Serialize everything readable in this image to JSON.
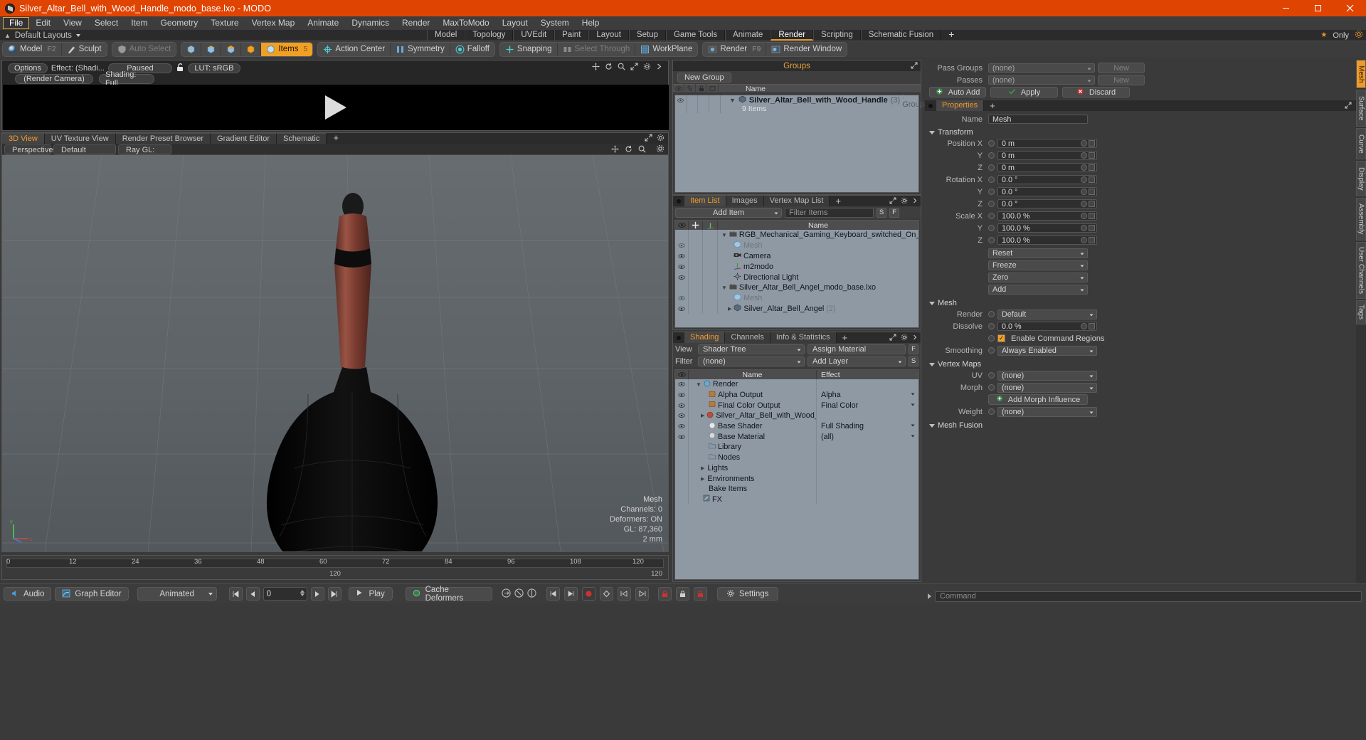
{
  "titlebar": {
    "title": "Silver_Altar_Bell_with_Wood_Handle_modo_base.lxo - MODO",
    "minimize": "—",
    "maximize": "❐",
    "close": "✕"
  },
  "menu": {
    "items": [
      "File",
      "Edit",
      "View",
      "Select",
      "Item",
      "Geometry",
      "Texture",
      "Vertex Map",
      "Animate",
      "Dynamics",
      "Render",
      "MaxToModo",
      "Layout",
      "System",
      "Help"
    ],
    "active": "File"
  },
  "layoutbar": {
    "label": "Default Layouts",
    "tabs": [
      "Model",
      "Topology",
      "UVEdit",
      "Paint",
      "Layout",
      "Setup",
      "Game Tools",
      "Animate",
      "Render",
      "Scripting",
      "Schematic Fusion"
    ],
    "selected": "Render",
    "plus": "+",
    "only_label": "Only"
  },
  "modebar": {
    "group1": [
      {
        "label": "Model",
        "hotkey": "F2",
        "icon": "sphere-icon"
      },
      {
        "label": "Sculpt",
        "hotkey": "",
        "icon": "brush-icon"
      }
    ],
    "group2": [
      {
        "label": "Auto Select",
        "hotkey": "",
        "icon": "shield-icon",
        "dim": true
      }
    ],
    "group3": [
      {
        "label": "",
        "icon": "vertex-icon"
      },
      {
        "label": "",
        "icon": "edge-icon"
      },
      {
        "label": "",
        "icon": "polygon-icon"
      },
      {
        "label": "",
        "icon": "material-icon"
      },
      {
        "label": "Items",
        "hotkey": "5",
        "icon": "items-icon",
        "on": true
      }
    ],
    "group4": [
      {
        "label": "Action Center",
        "icon": "action-center-icon"
      },
      {
        "label": "Symmetry",
        "icon": "symmetry-icon"
      },
      {
        "label": "Falloff",
        "icon": "falloff-icon"
      }
    ],
    "group5": [
      {
        "label": "Snapping",
        "icon": "snapping-icon"
      },
      {
        "label": "Select Through",
        "icon": "select-through-icon",
        "dim": true
      },
      {
        "label": "WorkPlane",
        "icon": "workplane-icon"
      }
    ],
    "group6": [
      {
        "label": "Render",
        "hotkey": "F9",
        "icon": "render-icon"
      },
      {
        "label": "Render Window",
        "hotkey": "",
        "icon": "render-window-icon"
      }
    ]
  },
  "render_preview": {
    "options": "Options",
    "effect": "Effect: (Shadi...",
    "paused": "Paused",
    "lut": "LUT: sRGB",
    "camera": "(Render Camera)",
    "shading": "Shading: Full"
  },
  "viewport": {
    "tabs": [
      "3D View",
      "UV Texture View",
      "Render Preset Browser",
      "Gradient Editor",
      "Schematic"
    ],
    "selected": "3D View",
    "plus": "+",
    "sub_buttons": [
      "Perspective",
      "Default",
      "Ray GL: Off"
    ],
    "stats": {
      "title": "Mesh",
      "channels": "Channels: 0",
      "deformers": "Deformers: ON",
      "gl": "GL: 87,360",
      "scale": "2 mm"
    }
  },
  "timeline": {
    "ticks": [
      "0",
      "12",
      "24",
      "36",
      "48",
      "60",
      "72",
      "84",
      "96",
      "108",
      "120"
    ],
    "total_center": "120",
    "total_right": "120"
  },
  "bottombar": {
    "audio": "Audio",
    "graph_editor": "Graph Editor",
    "animated": "Animated",
    "frame": "0",
    "play": "Play",
    "cache_deformers": "Cache Deformers",
    "settings": "Settings"
  },
  "groups_panel": {
    "title": "Groups",
    "new_group": "New Group",
    "columns": [
      "",
      "",
      "",
      "",
      "Name"
    ],
    "rows": [
      {
        "name": "Silver_Altar_Bell_with_Wood_Handle",
        "count": "(3)",
        "type": ": Group",
        "sub": "9 Items"
      }
    ]
  },
  "item_list_panel": {
    "tabs": [
      "Item List",
      "Images",
      "Vertex Map List"
    ],
    "selected": "Item List",
    "plus": "+",
    "add_item": "Add Item",
    "filter_placeholder": "Filter Items",
    "btn_s": "S",
    "btn_f": "F",
    "columns": [
      "eye-icon",
      "move-icon",
      "axis-icon",
      "Name"
    ],
    "rows": [
      {
        "name": "RGB_Mechanical_Gaming_Keyboard_switched_On_modo_b...",
        "icon": "scene-icon",
        "indent": 0,
        "expanded": true,
        "eye": false,
        "dim": false
      },
      {
        "name": "Mesh",
        "icon": "mesh-icon",
        "indent": 2,
        "eye": true,
        "dim": true
      },
      {
        "name": "Camera",
        "icon": "camera-icon",
        "indent": 2,
        "eye": true,
        "dim": false
      },
      {
        "name": "m2modo",
        "icon": "locator-icon",
        "indent": 2,
        "eye": true,
        "dim": false
      },
      {
        "name": "Directional Light",
        "icon": "light-icon",
        "indent": 2,
        "eye": true,
        "dim": false
      },
      {
        "name": "Silver_Altar_Bell_Angel_modo_base.lxo",
        "icon": "scene-icon",
        "indent": 0,
        "expanded": true,
        "eye": false,
        "dim": false
      },
      {
        "name": "Mesh",
        "icon": "mesh-icon",
        "indent": 2,
        "eye": true,
        "dim": true
      },
      {
        "name": "Silver_Altar_Bell_Angel",
        "count": "(2)",
        "icon": "group-icon",
        "indent": 2,
        "eye": true,
        "dim": false
      }
    ]
  },
  "shading_panel": {
    "tabs": [
      "Shading",
      "Channels",
      "Info & Statistics"
    ],
    "selected": "Shading",
    "plus": "+",
    "view_label": "View",
    "view_value": "Shader Tree",
    "assign_material": "Assign Material",
    "btn_f": "F",
    "filter_label": "Filter",
    "filter_value": "(none)",
    "add_layer": "Add Layer",
    "btn_s": "S",
    "columns": [
      "eye-icon",
      "Name",
      "Effect"
    ],
    "rows": [
      {
        "name": "Render",
        "effect": "",
        "icon": "render-node-icon",
        "indent": 1,
        "expanded": true,
        "eye": true
      },
      {
        "name": "Alpha Output",
        "effect": "Alpha",
        "icon": "output-icon",
        "indent": 2,
        "eye": true,
        "hasDrop": true
      },
      {
        "name": "Final Color Output",
        "effect": "Final Color",
        "icon": "output-icon",
        "indent": 2,
        "eye": true,
        "hasDrop": true
      },
      {
        "name": "Silver_Altar_Bell_with_Wood_Handle  (",
        "effect": "",
        "icon": "material-group-icon",
        "indent": 2,
        "eye": true,
        "expandable": true
      },
      {
        "name": "Base Shader",
        "effect": "Full Shading",
        "icon": "shader-icon",
        "indent": 3,
        "eye": true,
        "hasDrop": true
      },
      {
        "name": "Base Material",
        "effect": "(all)",
        "icon": "material-sphere-icon",
        "indent": 3,
        "eye": true,
        "hasDrop": true
      },
      {
        "name": "Library",
        "effect": "",
        "icon": "folder-icon",
        "indent": 2,
        "eye": false
      },
      {
        "name": "Nodes",
        "effect": "",
        "icon": "folder-icon",
        "indent": 2,
        "eye": false
      },
      {
        "name": "Lights",
        "effect": "",
        "icon": "",
        "indent": 1,
        "expandable": true,
        "eye": false
      },
      {
        "name": "Environments",
        "effect": "",
        "icon": "",
        "indent": 1,
        "expandable": true,
        "eye": false
      },
      {
        "name": "Bake Items",
        "effect": "",
        "icon": "",
        "indent": 1,
        "eye": false
      },
      {
        "name": "FX",
        "effect": "",
        "icon": "fx-icon",
        "indent": 1,
        "eye": false
      }
    ]
  },
  "properties": {
    "pass_groups_label": "Pass Groups",
    "pass_groups_value": "(none)",
    "new_btn": "New",
    "passes_label": "Passes",
    "passes_value": "(none)",
    "new_btn2": "New",
    "auto_add": "Auto Add",
    "apply": "Apply",
    "discard": "Discard",
    "header_tab": "Properties",
    "header_plus": "+",
    "name_label": "Name",
    "name_value": "Mesh",
    "transform_title": "Transform",
    "transform_rows": [
      {
        "label": "Position X",
        "value": "0 m"
      },
      {
        "label": "Y",
        "value": "0 m"
      },
      {
        "label": "Z",
        "value": "0 m"
      },
      {
        "label": "Rotation X",
        "value": "0.0 °"
      },
      {
        "label": "Y",
        "value": "0.0 °"
      },
      {
        "label": "Z",
        "value": "0.0 °"
      },
      {
        "label": "Scale X",
        "value": "100.0 %"
      },
      {
        "label": "Y",
        "value": "100.0 %"
      },
      {
        "label": "Z",
        "value": "100.0 %"
      }
    ],
    "transform_buttons": [
      "Reset",
      "Freeze",
      "Zero",
      "Add"
    ],
    "mesh_title": "Mesh",
    "mesh_rows": [
      {
        "label": "Render",
        "value": "Default",
        "type": "drop"
      },
      {
        "label": "Dissolve",
        "value": "0.0 %",
        "type": "field"
      }
    ],
    "enable_command_regions": "Enable Command Regions",
    "smoothing_label": "Smoothing",
    "smoothing_value": "Always Enabled",
    "vertex_maps_title": "Vertex Maps",
    "vertex_rows": [
      {
        "label": "UV",
        "value": "(none)"
      },
      {
        "label": "Morph",
        "value": "(none)"
      },
      {
        "label": "Weight",
        "value": "(none)"
      }
    ],
    "add_morph_influence": "Add Morph Influence",
    "mesh_fusion_title": "Mesh Fusion",
    "side_tabs": [
      "Mesh",
      "Surface",
      "Curve",
      "Display",
      "Assembly",
      "User Channels",
      "Tags"
    ],
    "side_selected": "Mesh",
    "command_placeholder": "Command"
  },
  "colors": {
    "title_bar": "#e04403",
    "accent": "#f0a024",
    "panel_bg": "#3a3a3a",
    "list_bg": "#8e99a4",
    "viewport_top": "#63686c"
  }
}
